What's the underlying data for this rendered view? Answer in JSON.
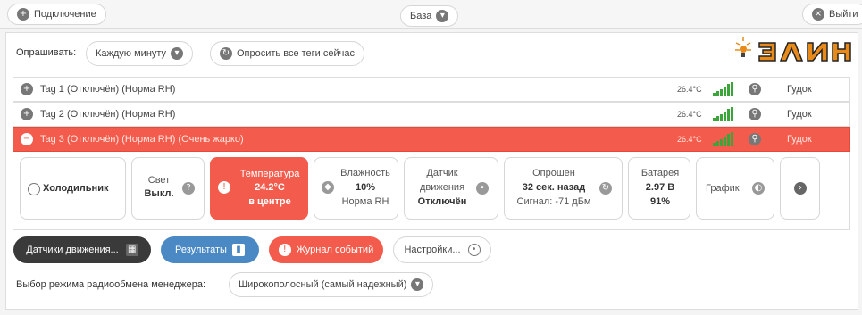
{
  "header": {
    "connect_label": "Подключение",
    "base_label": "База",
    "exit_label": "Выйти"
  },
  "poll": {
    "label": "Опрашивать:",
    "interval": "Каждую минуту",
    "poll_now": "Опросить все теги сейчас"
  },
  "logo": {
    "text": "ЭЛИН"
  },
  "tags": [
    {
      "name": "Tag 1 (Отключён) (Норма RH)",
      "temp": "26.4°C",
      "action": "Гудок",
      "active": false
    },
    {
      "name": "Tag 2 (Отключён) (Норма RH)",
      "temp": "26.4°C",
      "action": "Гудок",
      "active": false
    },
    {
      "name": "Tag 3 (Отключён) (Норма RH) (Очень жарко)",
      "temp": "26.4°C",
      "action": "Гудок",
      "active": true
    }
  ],
  "cards": {
    "fridge": "Холодильник",
    "light_title": "Свет",
    "light_value": "Выкл.",
    "temp_title": "Температура",
    "temp_value": "24.2°C",
    "temp_sub": "в центре",
    "humidity_title": "Влажность",
    "humidity_value": "10%",
    "humidity_sub": "Норма RH",
    "motion_title1": "Датчик",
    "motion_title2": "движения",
    "motion_value": "Отключён",
    "polled_title": "Опрошен",
    "polled_value": "32 сек. назад",
    "signal": "Сигнал: -71 дБм",
    "battery_title": "Батарея",
    "battery_value": "2.97 В",
    "battery_pct": "91%",
    "graph": "График"
  },
  "buttons": {
    "motion_sensors": "Датчики движения...",
    "results": "Результаты",
    "event_log": "Журнал событий",
    "settings": "Настройки..."
  },
  "radio": {
    "label": "Выбор режима радиообмена менеджера:",
    "value": "Широкополосный (самый надежный)"
  },
  "colors": {
    "accent_red": "#f35c4c",
    "accent_blue": "#4b89c5",
    "dark": "#3a3a3a",
    "signal_green": "#3aa63a",
    "logo_orange": "#e88a1a"
  }
}
